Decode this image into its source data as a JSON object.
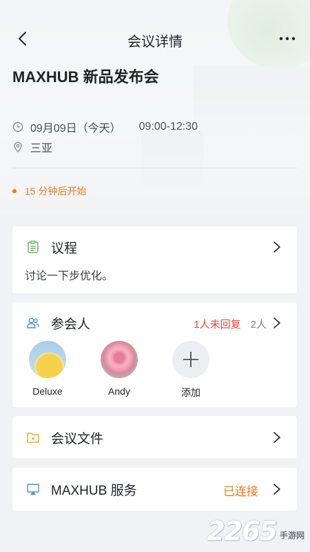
{
  "header": {
    "title": "会议详情"
  },
  "meeting": {
    "title": "MAXHUB 新品发布会",
    "date": "09月09日（今天）",
    "time": "09:00-12:30",
    "location": "三亚",
    "status": "15 分钟后开始"
  },
  "agenda": {
    "title": "议程",
    "content": "讨论一下步优化。"
  },
  "attendees": {
    "title": "参会人",
    "pending": "1人未回复",
    "count": "2人",
    "people": [
      {
        "name": "Deluxe"
      },
      {
        "name": "Andy"
      }
    ],
    "add_label": "添加"
  },
  "files": {
    "title": "会议文件"
  },
  "service": {
    "title": "MAXHUB 服务",
    "status": "已连接"
  },
  "watermark": {
    "number": "2265",
    "suffix": "手游网"
  },
  "colors": {
    "accent_orange": "#f07a15",
    "alert_red": "#e8463e",
    "background": "#f1f2f5",
    "card": "#ffffff"
  }
}
